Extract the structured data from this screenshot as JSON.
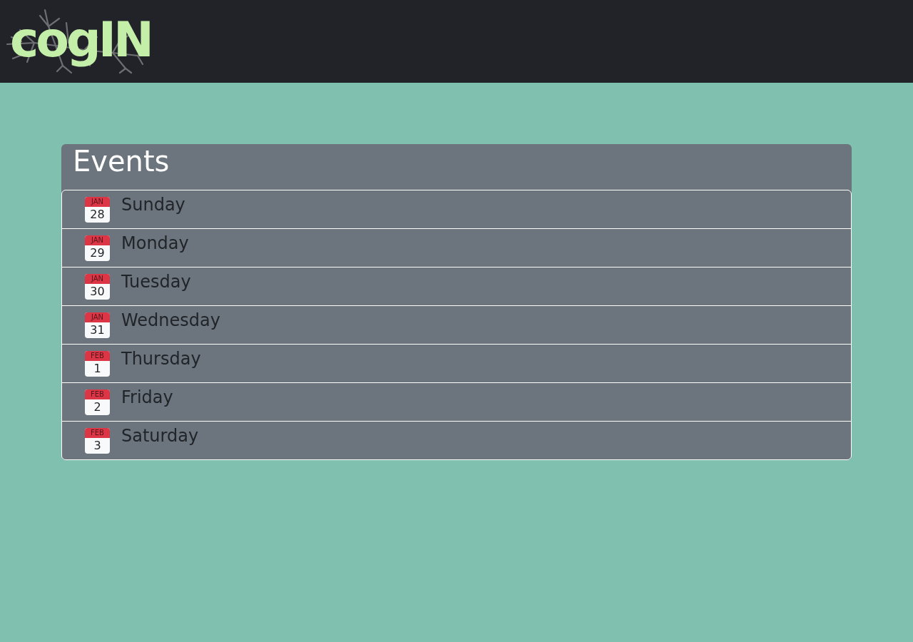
{
  "header": {
    "logo": {
      "text": "cogIN"
    }
  },
  "events": {
    "title": "Events",
    "items": [
      {
        "month": "JAN",
        "day": "28",
        "name": "Sunday"
      },
      {
        "month": "JAN",
        "day": "29",
        "name": "Monday"
      },
      {
        "month": "JAN",
        "day": "30",
        "name": "Tuesday"
      },
      {
        "month": "JAN",
        "day": "31",
        "name": "Wednesday"
      },
      {
        "month": "FEB",
        "day": "1",
        "name": "Thursday"
      },
      {
        "month": "FEB",
        "day": "2",
        "name": "Friday"
      },
      {
        "month": "FEB",
        "day": "3",
        "name": "Saturday"
      }
    ]
  }
}
